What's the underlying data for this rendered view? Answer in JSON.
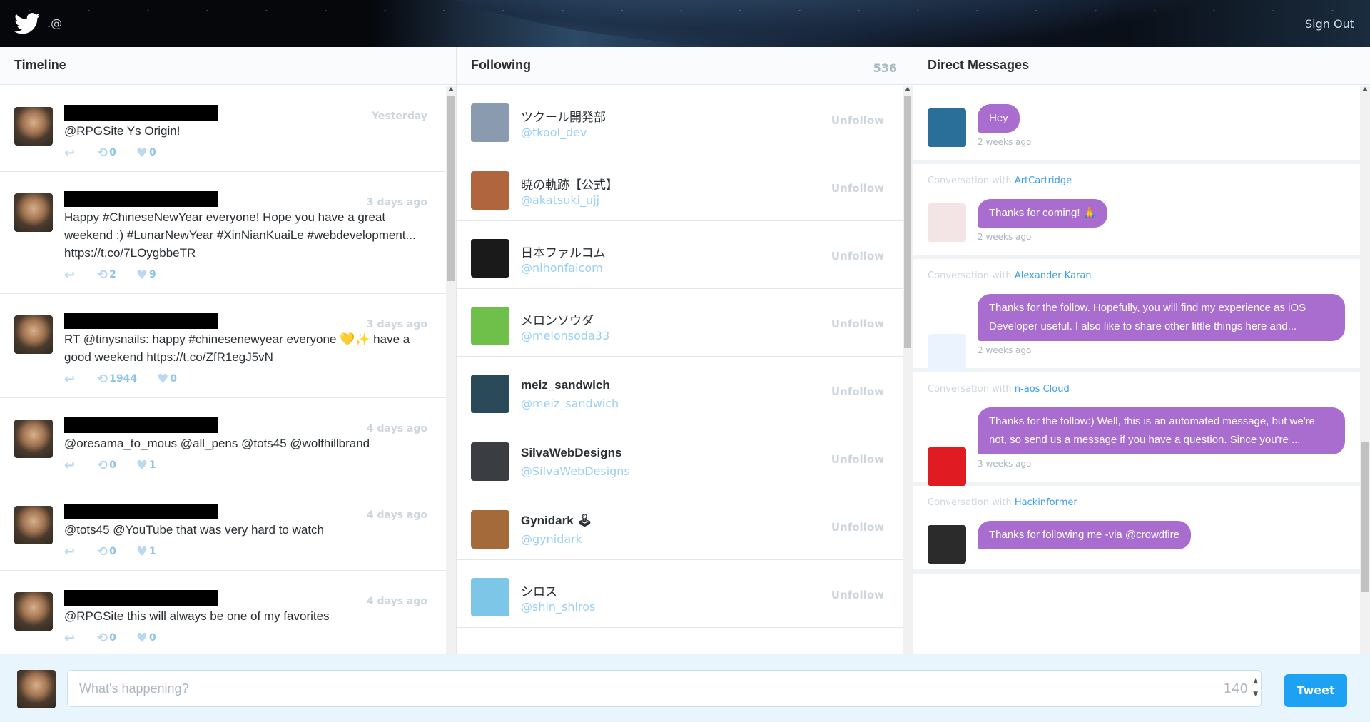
{
  "header": {
    "handle": ".@",
    "signout": "Sign Out"
  },
  "timeline": {
    "title": "Timeline",
    "tweets": [
      {
        "time": "Yesterday",
        "text": "@RPGSite Ys Origin!",
        "retweets": "0",
        "likes": "0"
      },
      {
        "time": "3 days ago",
        "text": "Happy #ChineseNewYear everyone! Hope you have a great weekend :) #LunarNewYear #XinNianKuaiLe #webdevelopment... https://t.co/7LOygbbeTR",
        "retweets": "2",
        "likes": "9"
      },
      {
        "time": "3 days ago",
        "text": "RT @tinysnails: happy #chinesenewyear everyone 💛✨ have a good weekend https://t.co/ZfR1egJ5vN",
        "retweets": "1944",
        "likes": "0"
      },
      {
        "time": "4 days ago",
        "text": "@oresama_to_mous @all_pens @tots45 @wolfhillbrand",
        "retweets": "0",
        "likes": "1"
      },
      {
        "time": "4 days ago",
        "text": "@tots45 @YouTube that was very hard to watch",
        "retweets": "0",
        "likes": "1"
      },
      {
        "time": "4 days ago",
        "text": "@RPGSite this will always be one of my favorites",
        "retweets": "0",
        "likes": "0"
      }
    ]
  },
  "following": {
    "title": "Following",
    "count": "536",
    "unfollow_label": "Unfollow",
    "users": [
      {
        "name": "ツクール開発部",
        "handle": "@tkool_dev",
        "color": "#8a9bb0"
      },
      {
        "name": "暁の軌跡【公式】",
        "handle": "@akatsuki_ujj",
        "color": "#b0653e"
      },
      {
        "name": "日本ファルコム",
        "handle": "@nihonfalcom",
        "color": "#1a1a1a"
      },
      {
        "name": "メロンソウダ",
        "handle": "@melonsoda33",
        "color": "#6fbf4b"
      },
      {
        "name": "meiz_sandwich",
        "handle": "@meiz_sandwich",
        "color": "#2a4a5a"
      },
      {
        "name": "SilvaWebDesigns",
        "handle": "@SilvaWebDesigns",
        "color": "#3a3d42"
      },
      {
        "name": "Gynidark 🕹",
        "handle": "@gynidark",
        "color": "#a46a3a"
      },
      {
        "name": "シロス",
        "handle": "@shin_shiros",
        "color": "#7ec6e8"
      }
    ]
  },
  "dm": {
    "title": "Direct Messages",
    "conversation_prefix": "Conversation with",
    "messages": [
      {
        "with": "",
        "text": "Hey",
        "ago": "2 weeks ago",
        "color": "#2a6e9a"
      },
      {
        "with": "ArtCartridge",
        "text": "Thanks for coming! 🙏",
        "ago": "2 weeks ago",
        "color": "#f3e5e5"
      },
      {
        "with": "Alexander Karan",
        "text": "Thanks for the follow. Hopefully, you will find my experience as iOS Developer useful. I also like to share other little things here and...",
        "ago": "2 weeks ago",
        "color": "#eaf3ff"
      },
      {
        "with": "n-aos Cloud",
        "text": "Thanks for the follow:) Well, this is an automated message, but we're not, so send us a message if you have a question. Since you're ...",
        "ago": "3 weeks ago",
        "color": "#e01b22"
      },
      {
        "with": "Hackinformer",
        "text": "Thanks for following me -via @crowdfire",
        "ago": "",
        "color": "#2b2b2b"
      }
    ]
  },
  "composer": {
    "placeholder": "What's happening?",
    "remaining": "140",
    "button": "Tweet"
  },
  "colors": {
    "accent": "#1da1f2",
    "bubble": "#a86dcf",
    "link": "#3a9ee8"
  }
}
